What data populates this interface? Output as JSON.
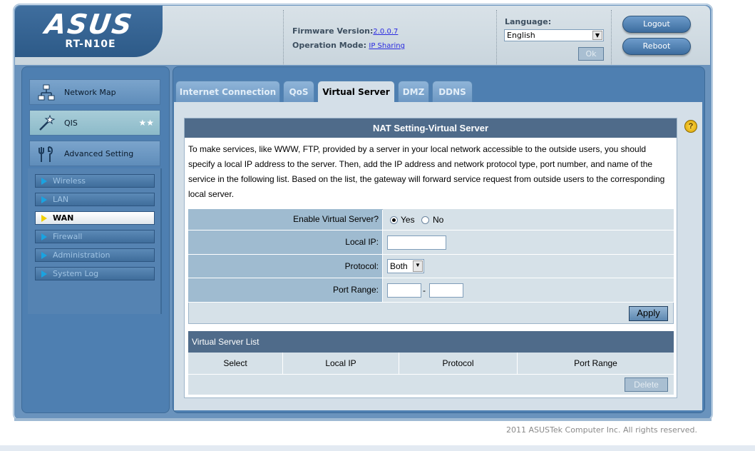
{
  "header": {
    "brand": "ASUS",
    "model": "RT-N10E",
    "firmware_label": "Firmware Version:",
    "firmware_value": "2.0.0.7",
    "mode_label": "Operation Mode:",
    "mode_value": "IP Sharing",
    "language_label": "Language:",
    "language_value": "English",
    "ok_label": "Ok",
    "logout_label": "Logout",
    "reboot_label": "Reboot"
  },
  "sidebar": {
    "main": [
      {
        "label": "Network Map",
        "icon": "network-map-icon"
      },
      {
        "label": "QIS",
        "icon": "magic-wand-icon"
      },
      {
        "label": "Advanced Setting",
        "icon": "tools-icon"
      }
    ],
    "sub": [
      {
        "label": "Wireless"
      },
      {
        "label": "LAN"
      },
      {
        "label": "WAN"
      },
      {
        "label": "Firewall"
      },
      {
        "label": "Administration"
      },
      {
        "label": "System Log"
      }
    ]
  },
  "tabs": [
    {
      "label": "Internet Connection"
    },
    {
      "label": "QoS"
    },
    {
      "label": "Virtual Server"
    },
    {
      "label": "DMZ"
    },
    {
      "label": "DDNS"
    }
  ],
  "panel": {
    "title": "NAT Setting-Virtual Server",
    "description": "To make services, like WWW, FTP, provided by a server in your local network accessible to the outside users, you should specify a local IP address to the server. Then, add the IP address and network protocol type, port number, and name of the service in the following list. Based on the list, the gateway will forward service request from outside users to the corresponding local server.",
    "enable_label": "Enable Virtual Server?",
    "yes_label": "Yes",
    "no_label": "No",
    "enable_value": "Yes",
    "local_ip_label": "Local IP:",
    "local_ip_value": "",
    "protocol_label": "Protocol:",
    "protocol_value": "Both",
    "port_range_label": "Port Range:",
    "port_from": "",
    "port_to": "",
    "port_separator": "-",
    "apply_label": "Apply"
  },
  "list": {
    "title": "Virtual Server List",
    "columns": [
      "Select",
      "Local IP",
      "Protocol",
      "Port Range"
    ],
    "delete_label": "Delete"
  },
  "footer": {
    "copyright": "2011 ASUSTek Computer Inc. All rights reserved."
  },
  "colors": {
    "header_dark_blue": "#2d5a88",
    "panel_title": "#4f6b8a",
    "label_cell": "#9fbbd0",
    "active_marker": "#f0d000"
  }
}
